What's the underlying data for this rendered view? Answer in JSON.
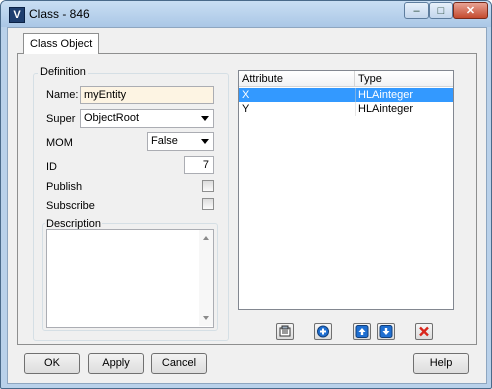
{
  "window": {
    "title": "Class - 846",
    "app_icon_letter": "V",
    "controls": {
      "minimize": "–",
      "maximize": "□",
      "close": "✕"
    }
  },
  "tabs": [
    {
      "label": "Class Object",
      "active": true
    }
  ],
  "definition": {
    "group_label": "Definition",
    "name": {
      "label": "Name:",
      "value": "myEntity"
    },
    "super": {
      "label": "Super",
      "value": "ObjectRoot"
    },
    "mom": {
      "label": "MOM",
      "value": "False"
    },
    "id": {
      "label": "ID",
      "value": "7"
    },
    "publish": {
      "label": "Publish",
      "checked": false
    },
    "subscribe": {
      "label": "Subscribe",
      "checked": false
    },
    "description": {
      "label": "Description",
      "value": ""
    }
  },
  "attributes": {
    "columns": [
      "Attribute",
      "Type"
    ],
    "rows": [
      {
        "attribute": "X",
        "type": "HLAinteger",
        "selected": true
      },
      {
        "attribute": "Y",
        "type": "HLAinteger",
        "selected": false
      }
    ]
  },
  "attribute_toolbar": [
    {
      "name": "properties-icon"
    },
    {
      "name": "add-icon"
    },
    {
      "name": "move-up-icon"
    },
    {
      "name": "move-down-icon"
    },
    {
      "name": "delete-icon"
    }
  ],
  "buttons": {
    "ok": "OK",
    "apply": "Apply",
    "cancel": "Cancel",
    "help": "Help"
  },
  "colors": {
    "selection": "#3399ff",
    "name_field_bg": "#fdf4e3",
    "accent_blue": "#1f6fd1",
    "delete_red": "#d9261c"
  }
}
